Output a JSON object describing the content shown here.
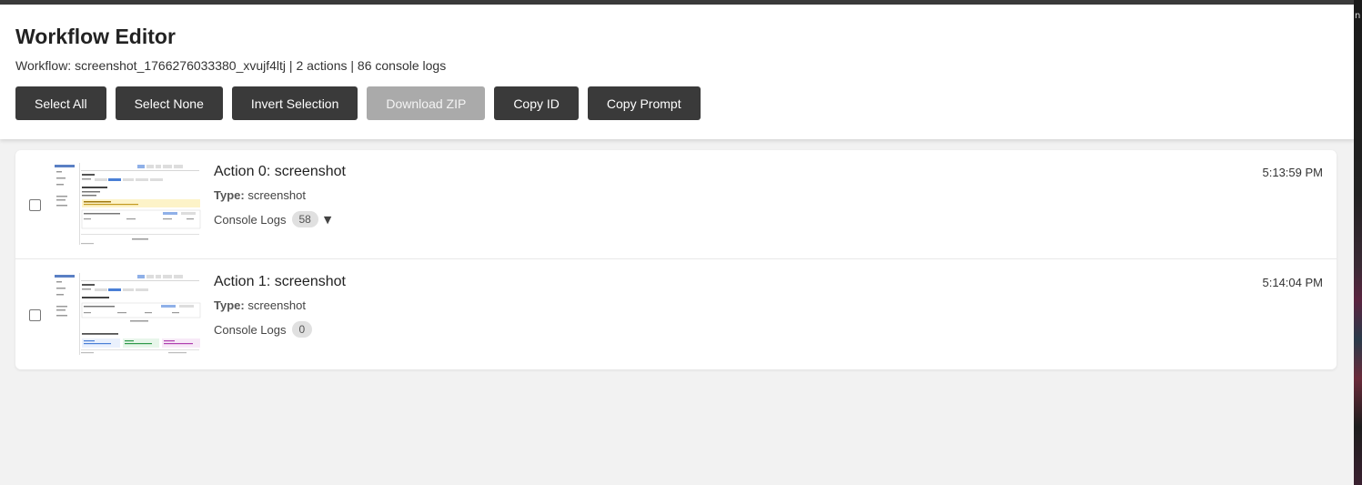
{
  "header": {
    "title": "Workflow Editor",
    "subtitle": "Workflow: screenshot_1766276033380_xvujf4ltj | 2 actions | 86 console logs"
  },
  "toolbar": {
    "select_all": "Select All",
    "select_none": "Select None",
    "invert_selection": "Invert Selection",
    "download_zip": "Download ZIP",
    "copy_id": "Copy ID",
    "copy_prompt": "Copy Prompt"
  },
  "actions": [
    {
      "title": "Action 0: screenshot",
      "type_label": "Type:",
      "type_value": "screenshot",
      "logs_label": "Console Logs",
      "logs_count": "58",
      "expand_icon": "▼",
      "time": "5:13:59 PM",
      "checked": false
    },
    {
      "title": "Action 1: screenshot",
      "type_label": "Type:",
      "type_value": "screenshot",
      "logs_label": "Console Logs",
      "logs_count": "0",
      "time": "5:14:04 PM",
      "checked": false
    }
  ],
  "edge": {
    "glyph": "n"
  },
  "colors": {
    "button_bg": "#3a3a3a",
    "button_disabled_bg": "#aaaaaa",
    "badge_bg": "#e0e0e0",
    "page_bg": "#f2f2f2"
  }
}
